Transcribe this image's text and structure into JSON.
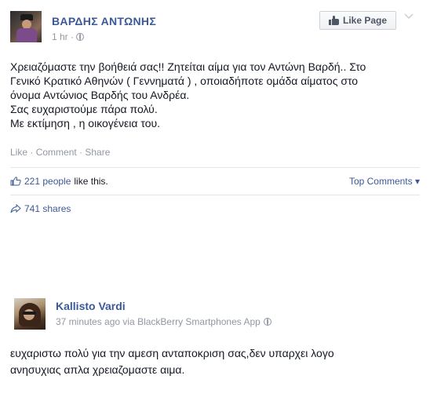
{
  "post1": {
    "author": "ΒΑΡΔΗΣ ΑΝΤΩΝΗΣ",
    "time": "1 hr ·",
    "privacy_icon": "globe-icon",
    "like_page_label": "Like Page",
    "body_lines": [
      "Χρειαζόμαστε την βοήθειά σας!! Ζητείται αίμα για τον Αντώνη Βαρδή.. Στο",
      "Γενικό Κρατικό Αθηνών ( Γεννηματά ) , οποιαδήποτε ομάδα αίματος στο",
      "όνομα Αντώνιος Βαρδής του Ανδρέα.",
      "Σας ευχαριστούμε πάρα πολύ.",
      "Με εκτίμηση , η οικογένεια του."
    ],
    "actions": {
      "like": "Like",
      "comment": "Comment",
      "share": "Share",
      "separator": " · "
    },
    "likes_count": "221 people",
    "likes_rest": "like this.",
    "top_comments": "Top Comments ▾",
    "shares": "741 shares"
  },
  "post2": {
    "author": "Kallisto Vardi",
    "meta": "37 minutes ago via BlackBerry Smartphones App",
    "privacy_icon": "globe-icon",
    "body_lines": [
      "ευχαριστω πολύ για την αμεση ανταποκριση σας,δεν υπαρχει λογο",
      "ανησυχιας απλα χρειαζομαστε αιμα."
    ]
  },
  "colors": {
    "link_blue": "#3b5998",
    "meta_gray": "#9197a3",
    "text": "#141823"
  }
}
